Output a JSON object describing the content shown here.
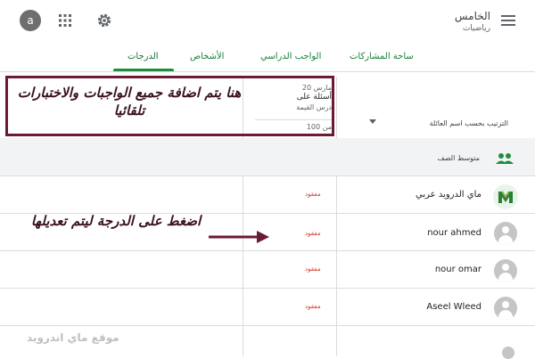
{
  "header": {
    "avatar_letter": "a",
    "class_name": "الخامس",
    "class_subject": "رياضيات"
  },
  "tabs": [
    {
      "label": "ساحة المشاركات"
    },
    {
      "label": "الواجب الدراسي"
    },
    {
      "label": "الأشخاص"
    },
    {
      "label": "الدرجات"
    }
  ],
  "assignment": {
    "date": "20 مارس",
    "title_line1": "أسئلة على",
    "title_line2": "درس القيمة",
    "total": "من 100"
  },
  "sort": {
    "label": "الترتيب بحسب اسم العائلة"
  },
  "class_average": {
    "label": "متوسط الصف"
  },
  "students": [
    {
      "name": "ماي الدرويد عربي",
      "grade": "مفقود"
    },
    {
      "name": "nour ahmed",
      "grade": "مفقود"
    },
    {
      "name": "nour omar",
      "grade": "مفقود"
    },
    {
      "name": "Aseel Wleed",
      "grade": "مفقود"
    }
  ],
  "annotations": {
    "callout_top": "هنا يتم اضافة جميع الواجبات والاختبارات تلقائيا",
    "callout_edit": "اضغط على الدرجة ليتم تعديلها",
    "watermark": "موقع ماي اندرويد"
  },
  "colors": {
    "accent_green": "#1e8e3e",
    "missing_red": "#d93025",
    "annotation_border": "#6b1b33"
  }
}
